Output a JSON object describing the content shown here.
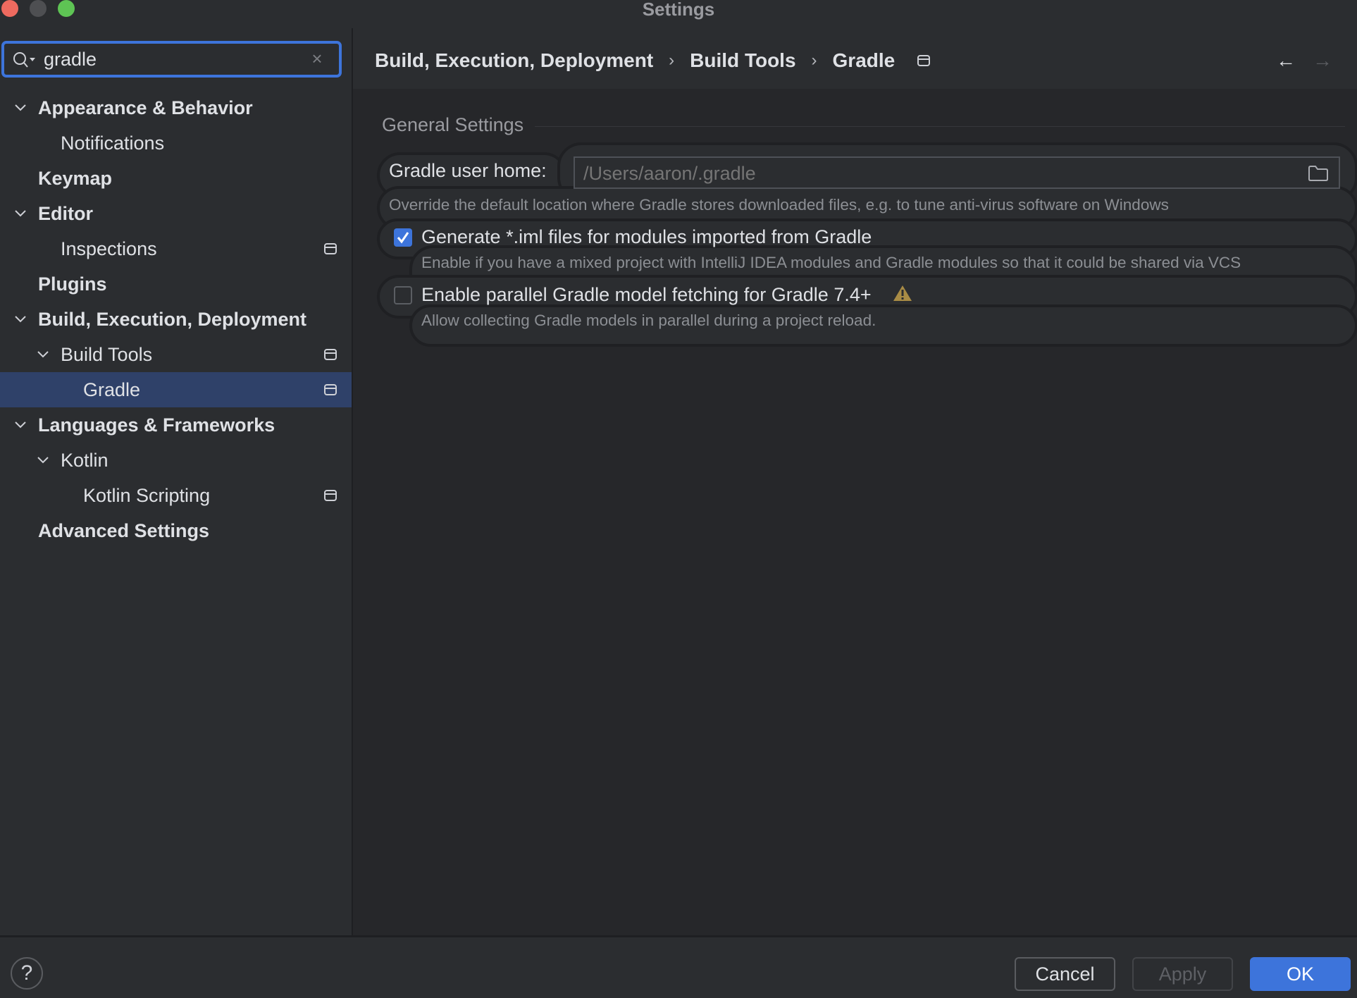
{
  "window": {
    "title": "Settings"
  },
  "search": {
    "value": "gradle",
    "placeholder": ""
  },
  "sidebar": {
    "items": [
      {
        "label": "Appearance & Behavior",
        "level": 0,
        "bold": true,
        "expandable": true,
        "project": false
      },
      {
        "label": "Notifications",
        "level": 1,
        "bold": false,
        "expandable": false,
        "project": false
      },
      {
        "label": "Keymap",
        "level": 0,
        "bold": true,
        "expandable": false,
        "project": false
      },
      {
        "label": "Editor",
        "level": 0,
        "bold": true,
        "expandable": true,
        "project": false
      },
      {
        "label": "Inspections",
        "level": 1,
        "bold": false,
        "expandable": false,
        "project": true
      },
      {
        "label": "Plugins",
        "level": 0,
        "bold": true,
        "expandable": false,
        "project": false
      },
      {
        "label": "Build, Execution, Deployment",
        "level": 0,
        "bold": true,
        "expandable": true,
        "project": false
      },
      {
        "label": "Build Tools",
        "level": 1,
        "bold": false,
        "expandable": true,
        "project": true
      },
      {
        "label": "Gradle",
        "level": 2,
        "bold": false,
        "expandable": false,
        "project": true,
        "selected": true
      },
      {
        "label": "Languages & Frameworks",
        "level": 0,
        "bold": true,
        "expandable": true,
        "project": false
      },
      {
        "label": "Kotlin",
        "level": 1,
        "bold": false,
        "expandable": true,
        "project": false
      },
      {
        "label": "Kotlin Scripting",
        "level": 2,
        "bold": false,
        "expandable": false,
        "project": true
      },
      {
        "label": "Advanced Settings",
        "level": 0,
        "bold": true,
        "expandable": false,
        "project": false
      }
    ]
  },
  "breadcrumb": [
    "Build, Execution, Deployment",
    "Build Tools",
    "Gradle"
  ],
  "breadcrumb_separator": "›",
  "nav": {
    "back": "←",
    "forward": "→"
  },
  "general": {
    "section_title": "General Settings",
    "user_home_label": "Gradle user home:",
    "user_home_placeholder": "/Users/aaron/.gradle",
    "user_home_hint": "Override the default location where Gradle stores downloaded files, e.g. to tune anti-virus software on Windows",
    "generate_iml": {
      "label": "Generate *.iml files for modules imported from Gradle",
      "checked": true,
      "hint": "Enable if you have a mixed project with IntelliJ IDEA modules and Gradle modules so that it could be shared via VCS"
    },
    "parallel_fetch": {
      "label": "Enable parallel Gradle model fetching for Gradle 7.4+",
      "checked": false,
      "hint": "Allow collecting Gradle models in parallel during a project reload."
    }
  },
  "footer": {
    "help": "?",
    "cancel": "Cancel",
    "apply": "Apply",
    "ok": "OK"
  },
  "colors": {
    "accent": "#3d74db",
    "selection": "#2f4169",
    "warning": "#a88b45"
  }
}
